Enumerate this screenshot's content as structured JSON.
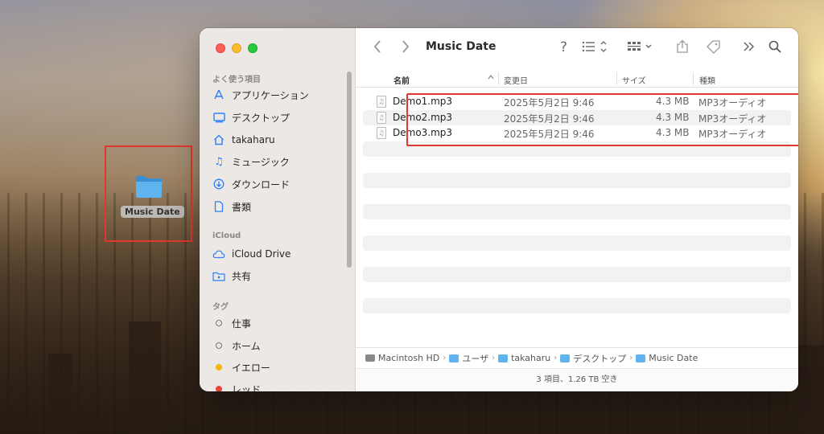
{
  "desktop": {
    "folder_label": "Music Date"
  },
  "window": {
    "title": "Music Date"
  },
  "sidebar": {
    "sections": {
      "favorites": "よく使う項目",
      "icloud": "iCloud",
      "tags": "タグ"
    },
    "favorites": [
      {
        "label": "アプリケーション",
        "icon": "applications-icon"
      },
      {
        "label": "デスクトップ",
        "icon": "desktop-icon"
      },
      {
        "label": "takaharu",
        "icon": "home-icon"
      },
      {
        "label": "ミュージック",
        "icon": "music-icon"
      },
      {
        "label": "ダウンロード",
        "icon": "downloads-icon"
      },
      {
        "label": "書類",
        "icon": "documents-icon"
      }
    ],
    "icloud": [
      {
        "label": "iCloud Drive",
        "icon": "cloud-icon"
      },
      {
        "label": "共有",
        "icon": "shared-folder-icon"
      }
    ],
    "tags": [
      {
        "label": "仕事",
        "color": ""
      },
      {
        "label": "ホーム",
        "color": ""
      },
      {
        "label": "イエロー",
        "color": "#f6b20e"
      },
      {
        "label": "レッド",
        "color": "#e8463a"
      }
    ]
  },
  "toolbar": {
    "back_icon": "chevron-left-icon",
    "forward_icon": "chevron-right-icon",
    "help": "?",
    "view_list_icon": "list-view-icon",
    "group_icon": "group-icon",
    "share_icon": "share-icon",
    "tag_icon": "tag-icon",
    "more_icon": "more-icon",
    "search_icon": "search-icon"
  },
  "columns": {
    "name": "名前",
    "modified": "変更日",
    "size": "サイズ",
    "kind": "種類"
  },
  "files": [
    {
      "name": "Demo1.mp3",
      "modified": "2025年5月2日 9:46",
      "size": "4.3 MB",
      "kind": "MP3オーディオ"
    },
    {
      "name": "Demo2.mp3",
      "modified": "2025年5月2日 9:46",
      "size": "4.3 MB",
      "kind": "MP3オーディオ"
    },
    {
      "name": "Demo3.mp3",
      "modified": "2025年5月2日 9:46",
      "size": "4.3 MB",
      "kind": "MP3オーディオ"
    }
  ],
  "pathbar": [
    {
      "label": "Macintosh HD",
      "type": "disk"
    },
    {
      "label": "ユーザ",
      "type": "folder"
    },
    {
      "label": "takaharu",
      "type": "folder"
    },
    {
      "label": "デスクトップ",
      "type": "folder"
    },
    {
      "label": "Music Date",
      "type": "folder"
    }
  ],
  "status": "3 項目、1.26 TB 空き",
  "colors": {
    "highlight_border": "#e0382e",
    "folder_blue": "#5fb3ef",
    "accent": "#2f7ff6"
  }
}
